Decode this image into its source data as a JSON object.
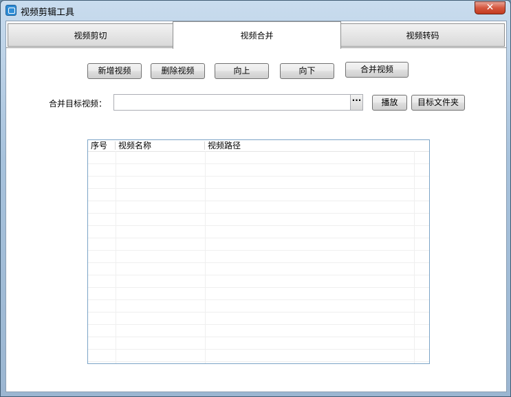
{
  "window": {
    "title": "视频剪辑工具",
    "close_symbol": "✕"
  },
  "tabs": [
    {
      "label": "视频剪切",
      "active": false
    },
    {
      "label": "视频合并",
      "active": true
    },
    {
      "label": "视频转码",
      "active": false
    }
  ],
  "toolbar": {
    "add_label": "新增视频",
    "delete_label": "删除视频",
    "up_label": "向上",
    "down_label": "向下",
    "merge_label": "合并视频"
  },
  "target": {
    "label": "合并目标视频：",
    "value": "",
    "browse_label": "···",
    "play_label": "播放",
    "folder_label": "目标文件夹"
  },
  "list": {
    "columns": [
      "序号",
      "视频名称",
      "视频路径"
    ],
    "rows": []
  }
}
